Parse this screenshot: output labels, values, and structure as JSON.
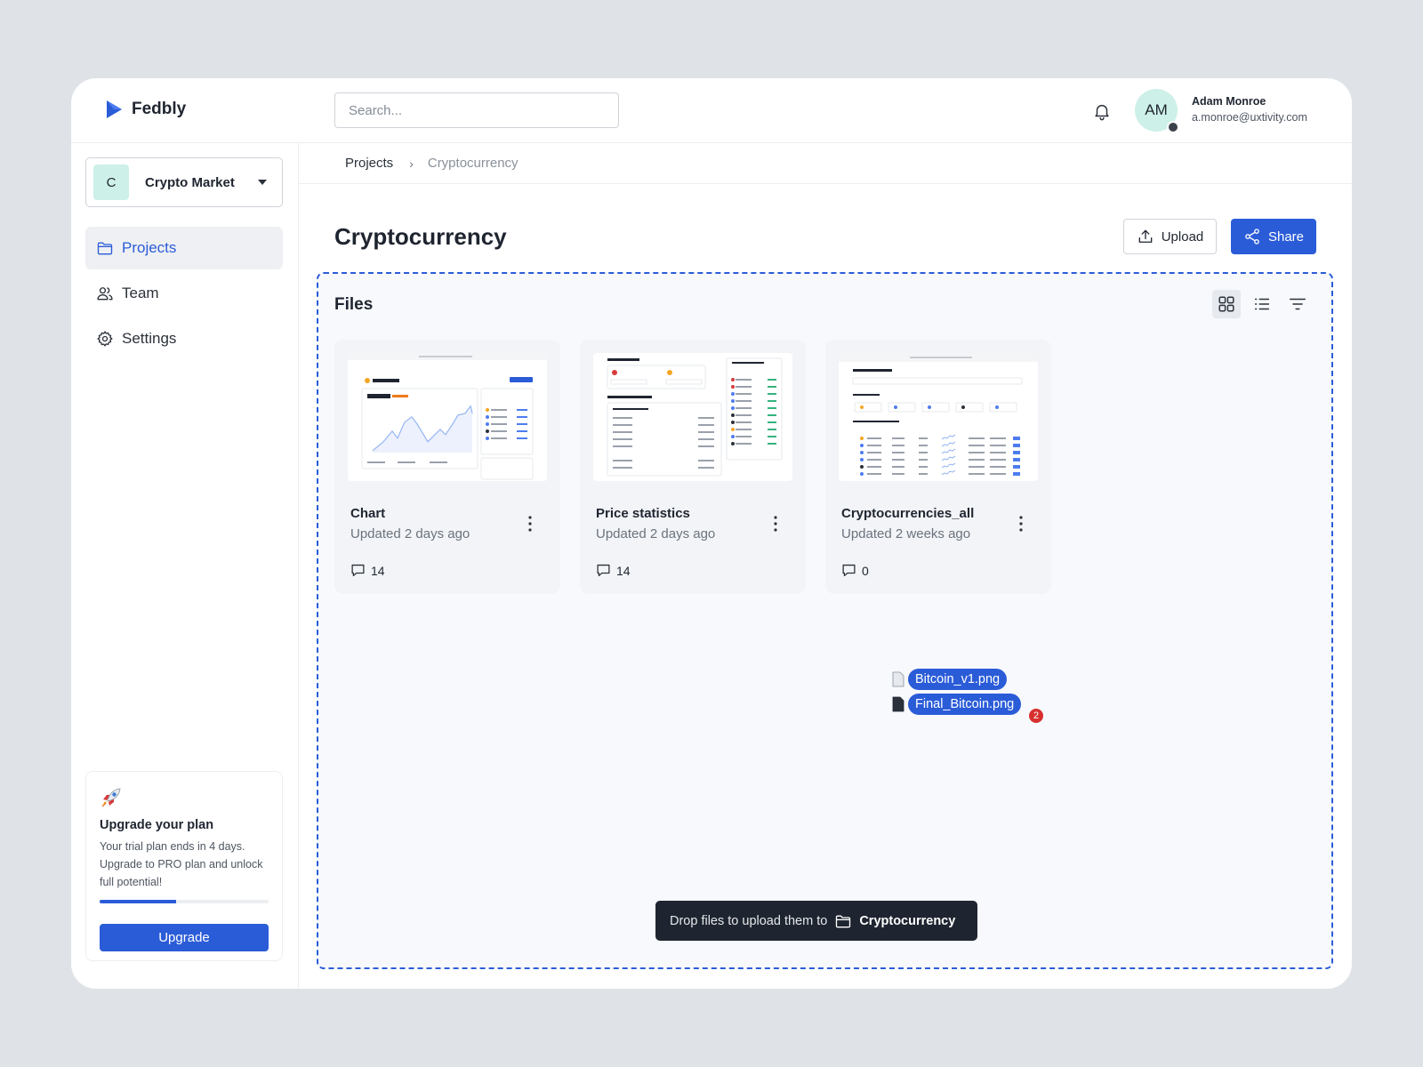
{
  "app": {
    "name": "Fedbly"
  },
  "search": {
    "placeholder": "Search..."
  },
  "user": {
    "initials": "AM",
    "name": "Adam Monroe",
    "email": "a.monroe@uxtivity.com"
  },
  "workspace": {
    "initial": "C",
    "name": "Crypto Market"
  },
  "nav": {
    "items": [
      {
        "label": "Projects",
        "icon": "folder-icon",
        "active": true
      },
      {
        "label": "Team",
        "icon": "users-icon",
        "active": false
      },
      {
        "label": "Settings",
        "icon": "gear-icon",
        "active": false
      }
    ]
  },
  "upgrade": {
    "title": "Upgrade your plan",
    "text": "Your trial plan ends in 4 days. Upgrade to PRO plan and unlock full potential!",
    "progress": 0.45,
    "button": "Upgrade"
  },
  "breadcrumb": {
    "parent": "Projects",
    "separator": "›",
    "current": "Cryptocurrency"
  },
  "page": {
    "title": "Cryptocurrency",
    "upload_label": "Upload",
    "share_label": "Share"
  },
  "files": {
    "title": "Files",
    "items": [
      {
        "name": "Chart",
        "updated": "Updated 2 days ago",
        "comments": "14"
      },
      {
        "name": "Price statistics",
        "updated": "Updated 2 days ago",
        "comments": "14"
      },
      {
        "name": "Cryptocurrencies_all",
        "updated": "Updated 2 weeks ago",
        "comments": "0"
      }
    ]
  },
  "drag": {
    "files": [
      "Bitcoin_v1.png",
      "Final_Bitcoin.png"
    ],
    "count": "2"
  },
  "drop_hint": {
    "text": "Drop files to upload them to",
    "folder": "Cryptocurrency"
  },
  "colors": {
    "accent": "#2b5cd8",
    "background": "#dfe2e6",
    "badge_red": "#d82f2f",
    "workspace_badge": "#cdf0e8"
  }
}
